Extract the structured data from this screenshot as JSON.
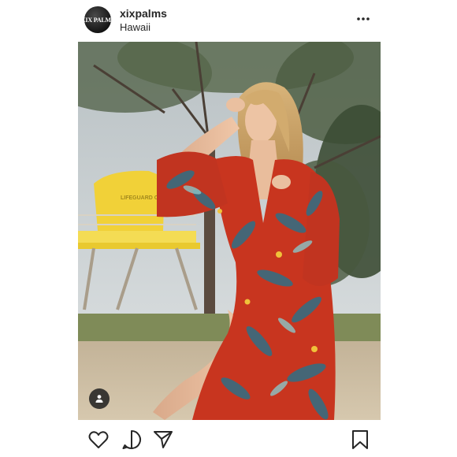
{
  "post": {
    "username": "xixpalms",
    "location": "Hawaii",
    "avatar": {
      "text": "XIX PALMS",
      "color": "#1a1a1a"
    }
  },
  "icons": {
    "more": "more-horizontal-icon",
    "tag": "user-tag-icon",
    "like": "heart-icon",
    "comment": "comment-icon",
    "share": "send-icon",
    "save": "bookmark-icon"
  },
  "photo": {
    "lifeguard_tower_text": "LIFEGUARD OFF DUTY",
    "colors": {
      "sky": "#cdd3d6",
      "tower": "#f3d33c",
      "dress": "#c8351f",
      "sand": "#c9b89c",
      "grass": "#7e8a52"
    }
  }
}
